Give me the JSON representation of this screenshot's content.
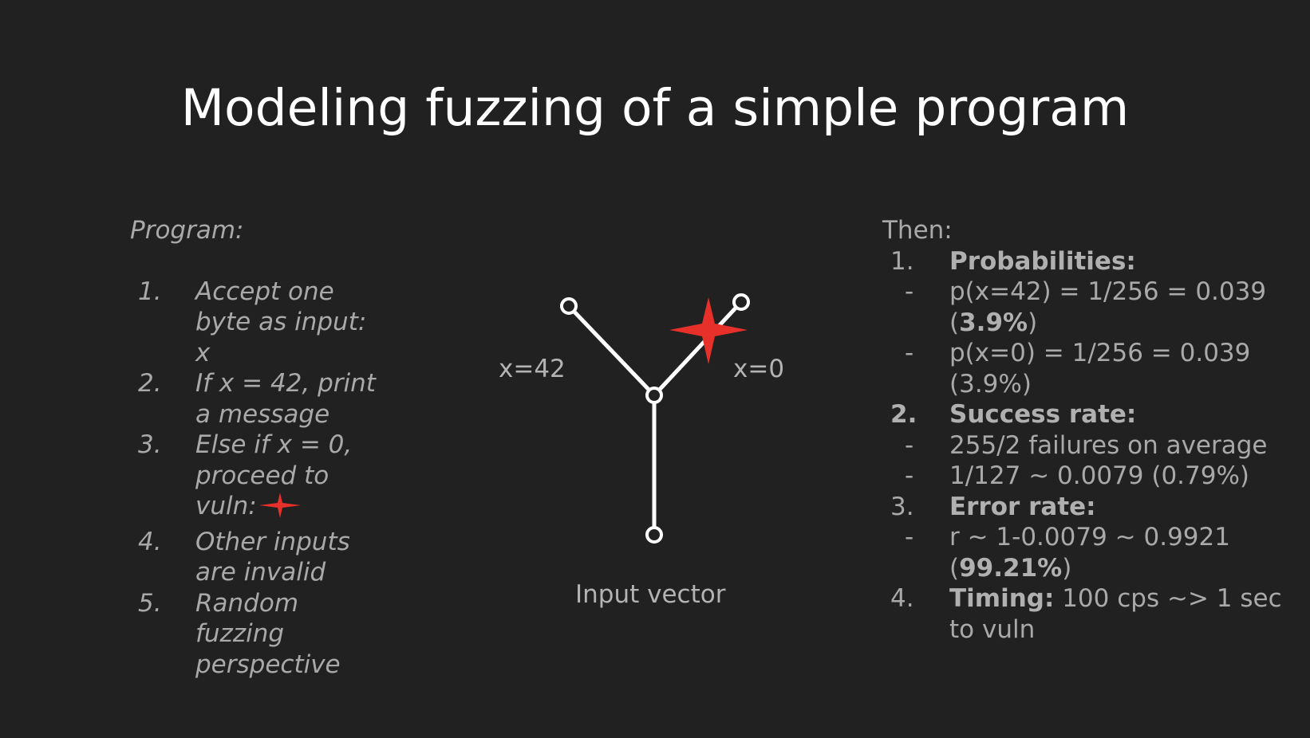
{
  "slide": {
    "title": "Modeling fuzzing of a simple program"
  },
  "program": {
    "heading": "Program:",
    "items": [
      {
        "num": "1.",
        "text": "Accept one byte as input: x"
      },
      {
        "num": "2.",
        "text": "If x = 42, print a message"
      },
      {
        "num": "3.",
        "text": "Else if x = 0, proceed to vuln:"
      },
      {
        "num": "4.",
        "text": "Other inputs are invalid"
      },
      {
        "num": "5.",
        "text": "Random fuzzing perspective"
      }
    ],
    "star_icon": "red-four-point-star-icon"
  },
  "diagram": {
    "label_left": "x=42",
    "label_right": "x=0",
    "caption": "Input vector",
    "line_color": "#ffffff",
    "star_color": "#e8302a",
    "star_icon": "red-four-point-star-icon"
  },
  "then": {
    "heading": "Then:",
    "sections": [
      {
        "num": "1.",
        "label": "Probabilities:",
        "bullets": [
          {
            "dash": "-",
            "parts": [
              "p(x=42) = 1/256 = 0.039 (",
              "3.9%",
              ")"
            ]
          },
          {
            "dash": "-",
            "text": "p(x=0) = 1/256 = 0.039 (3.9%)"
          }
        ]
      },
      {
        "num": "2.",
        "label": "Success rate:",
        "bullets": [
          {
            "dash": "-",
            "text": "255/2 failures on average"
          },
          {
            "dash": "-",
            "text": "1/127 ~ 0.0079 (0.79%)"
          }
        ]
      },
      {
        "num": "3.",
        "label": "Error rate:",
        "bullets": [
          {
            "dash": "-",
            "parts": [
              "r ~ 1-0.0079 ~ 0.9921 (",
              "99.21%",
              ")"
            ]
          }
        ]
      },
      {
        "num": "4.",
        "label": "Timing:",
        "text": " 100 cps ~> 1 sec to vuln"
      }
    ]
  },
  "colors": {
    "background": "#212121",
    "title": "#ffffff",
    "body_text": "#a9a9a9",
    "accent_red": "#e8302a"
  }
}
